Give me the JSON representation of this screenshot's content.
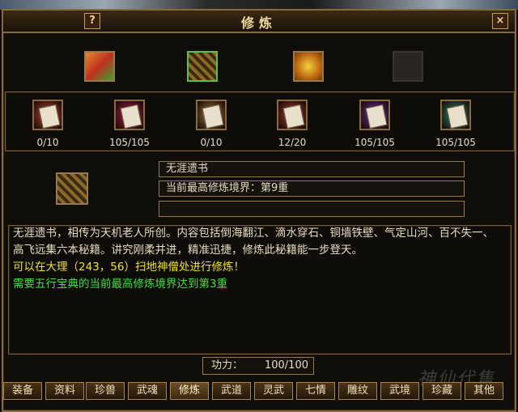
{
  "window": {
    "title": "修炼",
    "help_label": "?",
    "close_label": "×"
  },
  "top_icons": [
    "green-book-icon",
    "scroll-chest-icon",
    "gold-chest-icon",
    "empty-slot"
  ],
  "books": [
    {
      "name": "red-book-icon",
      "count": "0/10",
      "color": "#c0443a"
    },
    {
      "name": "crimson-book-icon",
      "count": "105/105",
      "color": "#b02050"
    },
    {
      "name": "tan-book-icon",
      "count": "0/10",
      "color": "#a07a40"
    },
    {
      "name": "red-book-icon",
      "count": "12/20",
      "color": "#a83a30"
    },
    {
      "name": "purple-book-icon",
      "count": "105/105",
      "color": "#6a30a0"
    },
    {
      "name": "teal-book-icon",
      "count": "105/105",
      "color": "#208a6a"
    }
  ],
  "detail": {
    "name": "无涯遗书",
    "realm": "当前最高修炼境界：第9重",
    "extra": ""
  },
  "description": {
    "text": "无涯遗书，相传为天机老人所创。内容包括倒海翻江、滴水穿石、铜墙铁壁、气定山河、百不失一、高飞远集六本秘籍。讲究刚柔并进，精准迅捷，修炼此秘籍能一步登天。",
    "location": "可以在大理（243，56）扫地神僧处进行修炼！",
    "requirement": "需要五行宝典的当前最高修炼境界达到第3重",
    "location_color": "#f0e030",
    "requirement_color": "#40e040"
  },
  "power": {
    "label": "功力：",
    "value": "100/100"
  },
  "tabs": [
    "装备",
    "资料",
    "珍兽",
    "武魂",
    "修炼",
    "武道",
    "灵武",
    "七情",
    "雕纹",
    "武境",
    "珍藏",
    "其他"
  ],
  "active_tab": "修炼",
  "watermark": "神仙代售"
}
